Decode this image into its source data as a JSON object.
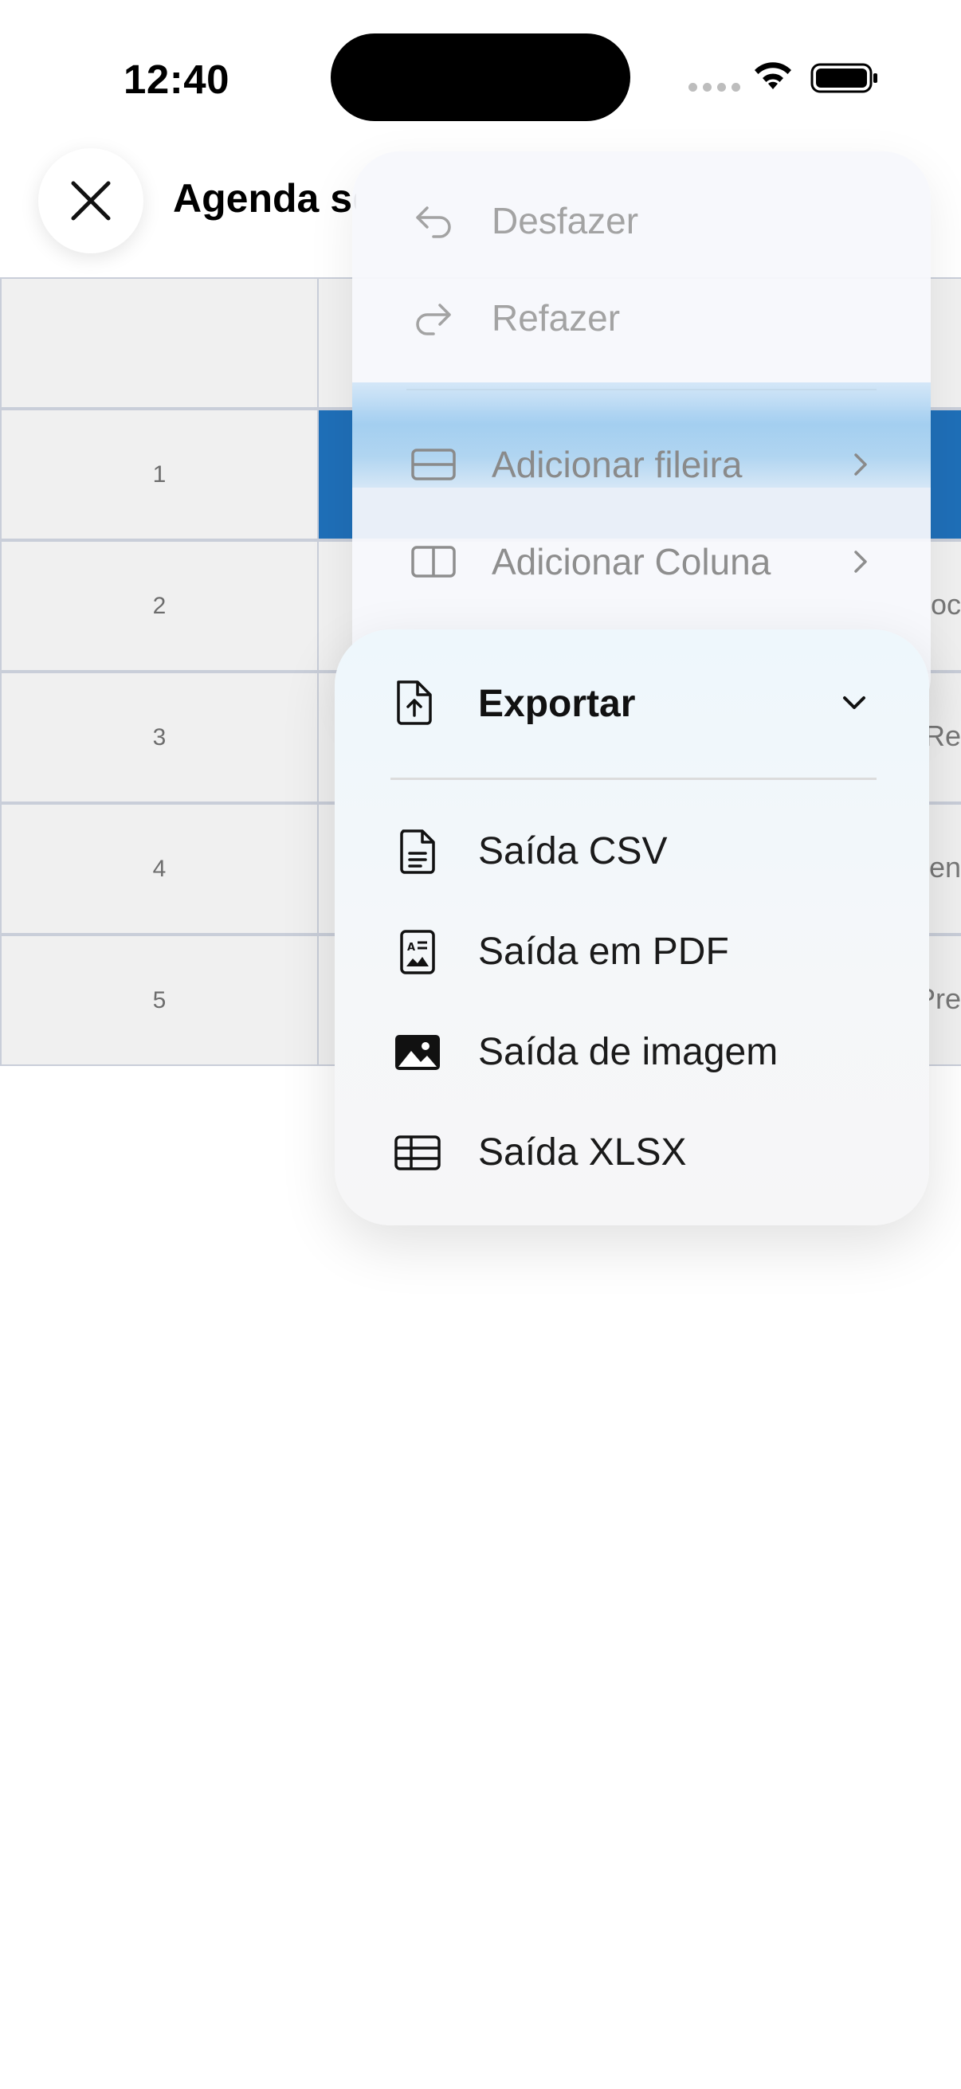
{
  "status_bar": {
    "time": "12:40"
  },
  "header": {
    "title": "Agenda semanal"
  },
  "grid": {
    "rows": [
      {
        "num": "1",
        "text": ""
      },
      {
        "num": "2",
        "text": "oc"
      },
      {
        "num": "3",
        "text": "Re"
      },
      {
        "num": "4",
        "text": "en"
      },
      {
        "num": "5",
        "text": "Pre"
      }
    ]
  },
  "menu_edit": {
    "undo": "Desfazer",
    "redo": "Refazer",
    "add_row": "Adicionar fileira",
    "add_column": "Adicionar Coluna"
  },
  "menu_export": {
    "title": "Exportar",
    "items": [
      {
        "label": "Saída CSV",
        "icon": "csv-file-icon"
      },
      {
        "label": "Saída em PDF",
        "icon": "pdf-file-icon"
      },
      {
        "label": "Saída de imagem",
        "icon": "image-icon"
      },
      {
        "label": "Saída XLSX",
        "icon": "table-icon"
      }
    ]
  },
  "colors": {
    "selected_cell": "#1f6fb8",
    "grid_bg": "#f0f0f0",
    "grid_border": "#c9ced9"
  }
}
